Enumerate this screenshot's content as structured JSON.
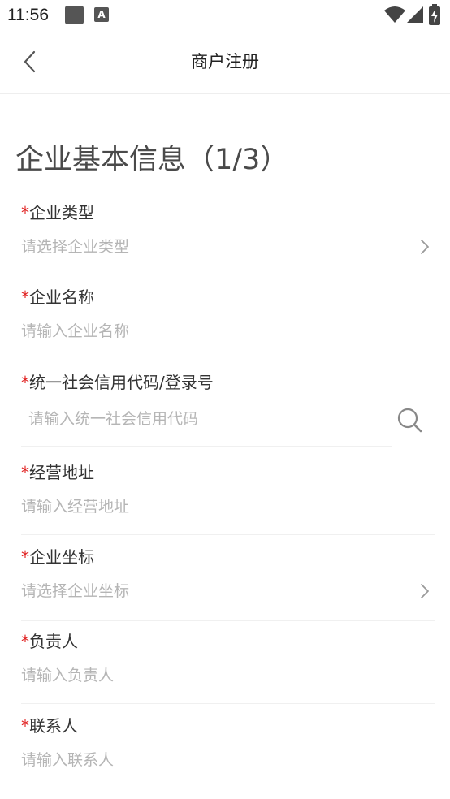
{
  "status_bar": {
    "time": "11:56",
    "notification_badge": "A"
  },
  "nav": {
    "title": "商户注册"
  },
  "section": {
    "title": "企业基本信息（1/3）"
  },
  "required_marker": "*",
  "fields": [
    {
      "label": "企业类型",
      "placeholder": "请选择企业类型",
      "value": "",
      "control": "select"
    },
    {
      "label": "企业名称",
      "placeholder": "请输入企业名称",
      "value": "",
      "control": "text"
    },
    {
      "label": "统一社会信用代码/登录号",
      "placeholder": "请输入统一社会信用代码",
      "value": "",
      "control": "search"
    },
    {
      "label": "经营地址",
      "placeholder": "请输入经营地址",
      "value": "",
      "control": "text"
    },
    {
      "label": "企业坐标",
      "placeholder": "请选择企业坐标",
      "value": "",
      "control": "select"
    },
    {
      "label": "负责人",
      "placeholder": "请输入负责人",
      "value": "",
      "control": "text"
    },
    {
      "label": "联系人",
      "placeholder": "请输入联系人",
      "value": "",
      "control": "text"
    }
  ],
  "colors": {
    "required": "#e02020",
    "placeholder": "#b5b5b5",
    "divider": "#f0f0f0",
    "title": "#4a4a4a"
  }
}
